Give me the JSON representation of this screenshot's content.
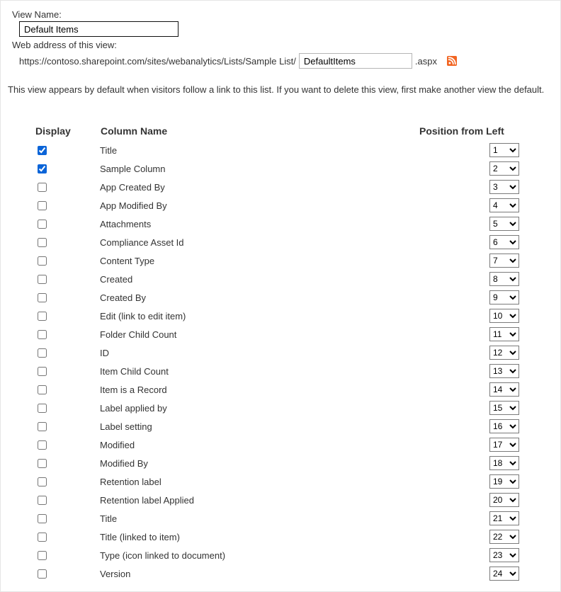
{
  "labels": {
    "view_name": "View Name:",
    "web_address": "Web address of this view:",
    "url_prefix": "https://contoso.sharepoint.com/sites/webanalytics/Lists/Sample List/",
    "url_suffix": ".aspx"
  },
  "inputs": {
    "view_name_value": "Default Items",
    "url_slug_value": "DefaultItems"
  },
  "description_text": "This view appears by default when visitors follow a link to this list. If you want to delete this view, first make another view the default.",
  "columns_table": {
    "headers": {
      "display": "Display",
      "column_name": "Column Name",
      "position": "Position from Left"
    },
    "rows": [
      {
        "checked": true,
        "name": "Title",
        "position": 1
      },
      {
        "checked": true,
        "name": "Sample Column",
        "position": 2
      },
      {
        "checked": false,
        "name": "App Created By",
        "position": 3
      },
      {
        "checked": false,
        "name": "App Modified By",
        "position": 4
      },
      {
        "checked": false,
        "name": "Attachments",
        "position": 5
      },
      {
        "checked": false,
        "name": "Compliance Asset Id",
        "position": 6
      },
      {
        "checked": false,
        "name": "Content Type",
        "position": 7
      },
      {
        "checked": false,
        "name": "Created",
        "position": 8
      },
      {
        "checked": false,
        "name": "Created By",
        "position": 9
      },
      {
        "checked": false,
        "name": "Edit (link to edit item)",
        "position": 10
      },
      {
        "checked": false,
        "name": "Folder Child Count",
        "position": 11
      },
      {
        "checked": false,
        "name": "ID",
        "position": 12
      },
      {
        "checked": false,
        "name": "Item Child Count",
        "position": 13
      },
      {
        "checked": false,
        "name": "Item is a Record",
        "position": 14
      },
      {
        "checked": false,
        "name": "Label applied by",
        "position": 15
      },
      {
        "checked": false,
        "name": "Label setting",
        "position": 16
      },
      {
        "checked": false,
        "name": "Modified",
        "position": 17
      },
      {
        "checked": false,
        "name": "Modified By",
        "position": 18
      },
      {
        "checked": false,
        "name": "Retention label",
        "position": 19
      },
      {
        "checked": false,
        "name": "Retention label Applied",
        "position": 20
      },
      {
        "checked": false,
        "name": "Title",
        "position": 21
      },
      {
        "checked": false,
        "name": "Title (linked to item)",
        "position": 22
      },
      {
        "checked": false,
        "name": "Type (icon linked to document)",
        "position": 23
      },
      {
        "checked": false,
        "name": "Version",
        "position": 24
      }
    ]
  }
}
